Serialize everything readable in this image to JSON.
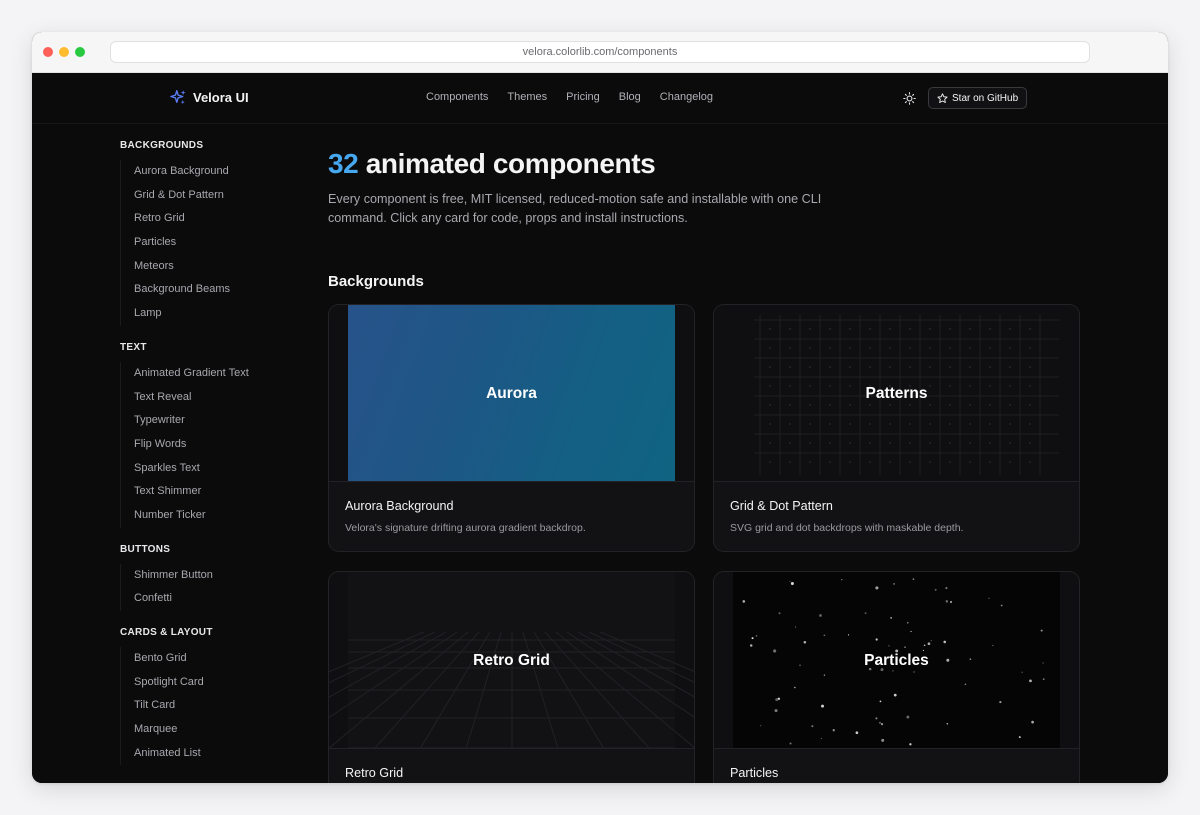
{
  "browser": {
    "url": "velora.colorlib.com/components"
  },
  "nav": {
    "brand": "Velora UI",
    "links": [
      "Components",
      "Themes",
      "Pricing",
      "Blog",
      "Changelog"
    ],
    "github_label": "Star on GitHub"
  },
  "sidebar": {
    "sections": [
      {
        "heading": "BACKGROUNDS",
        "items": [
          "Aurora Background",
          "Grid & Dot Pattern",
          "Retro Grid",
          "Particles",
          "Meteors",
          "Background Beams",
          "Lamp"
        ]
      },
      {
        "heading": "TEXT",
        "items": [
          "Animated Gradient Text",
          "Text Reveal",
          "Typewriter",
          "Flip Words",
          "Sparkles Text",
          "Text Shimmer",
          "Number Ticker"
        ]
      },
      {
        "heading": "BUTTONS",
        "items": [
          "Shimmer Button",
          "Confetti"
        ]
      },
      {
        "heading": "CARDS & LAYOUT",
        "items": [
          "Bento Grid",
          "Spotlight Card",
          "Tilt Card",
          "Marquee",
          "Animated List"
        ]
      }
    ]
  },
  "main": {
    "title_count": "32",
    "title_rest": " animated components",
    "description": "Every component is free, MIT licensed, reduced-motion safe and installable with one CLI command. Click any card for code, props and install instructions.",
    "section_title": "Backgrounds",
    "cards": [
      {
        "preview": "Aurora",
        "title": "Aurora Background",
        "desc": "Velora's signature drifting aurora gradient backdrop."
      },
      {
        "preview": "Patterns",
        "title": "Grid & Dot Pattern",
        "desc": "SVG grid and dot backdrops with maskable depth."
      },
      {
        "preview": "Retro Grid",
        "title": "Retro Grid",
        "desc": ""
      },
      {
        "preview": "Particles",
        "title": "Particles",
        "desc": ""
      }
    ]
  },
  "colors": {
    "accent": "#46a8ef",
    "background": "#0b0b0c",
    "card": "#121214"
  }
}
